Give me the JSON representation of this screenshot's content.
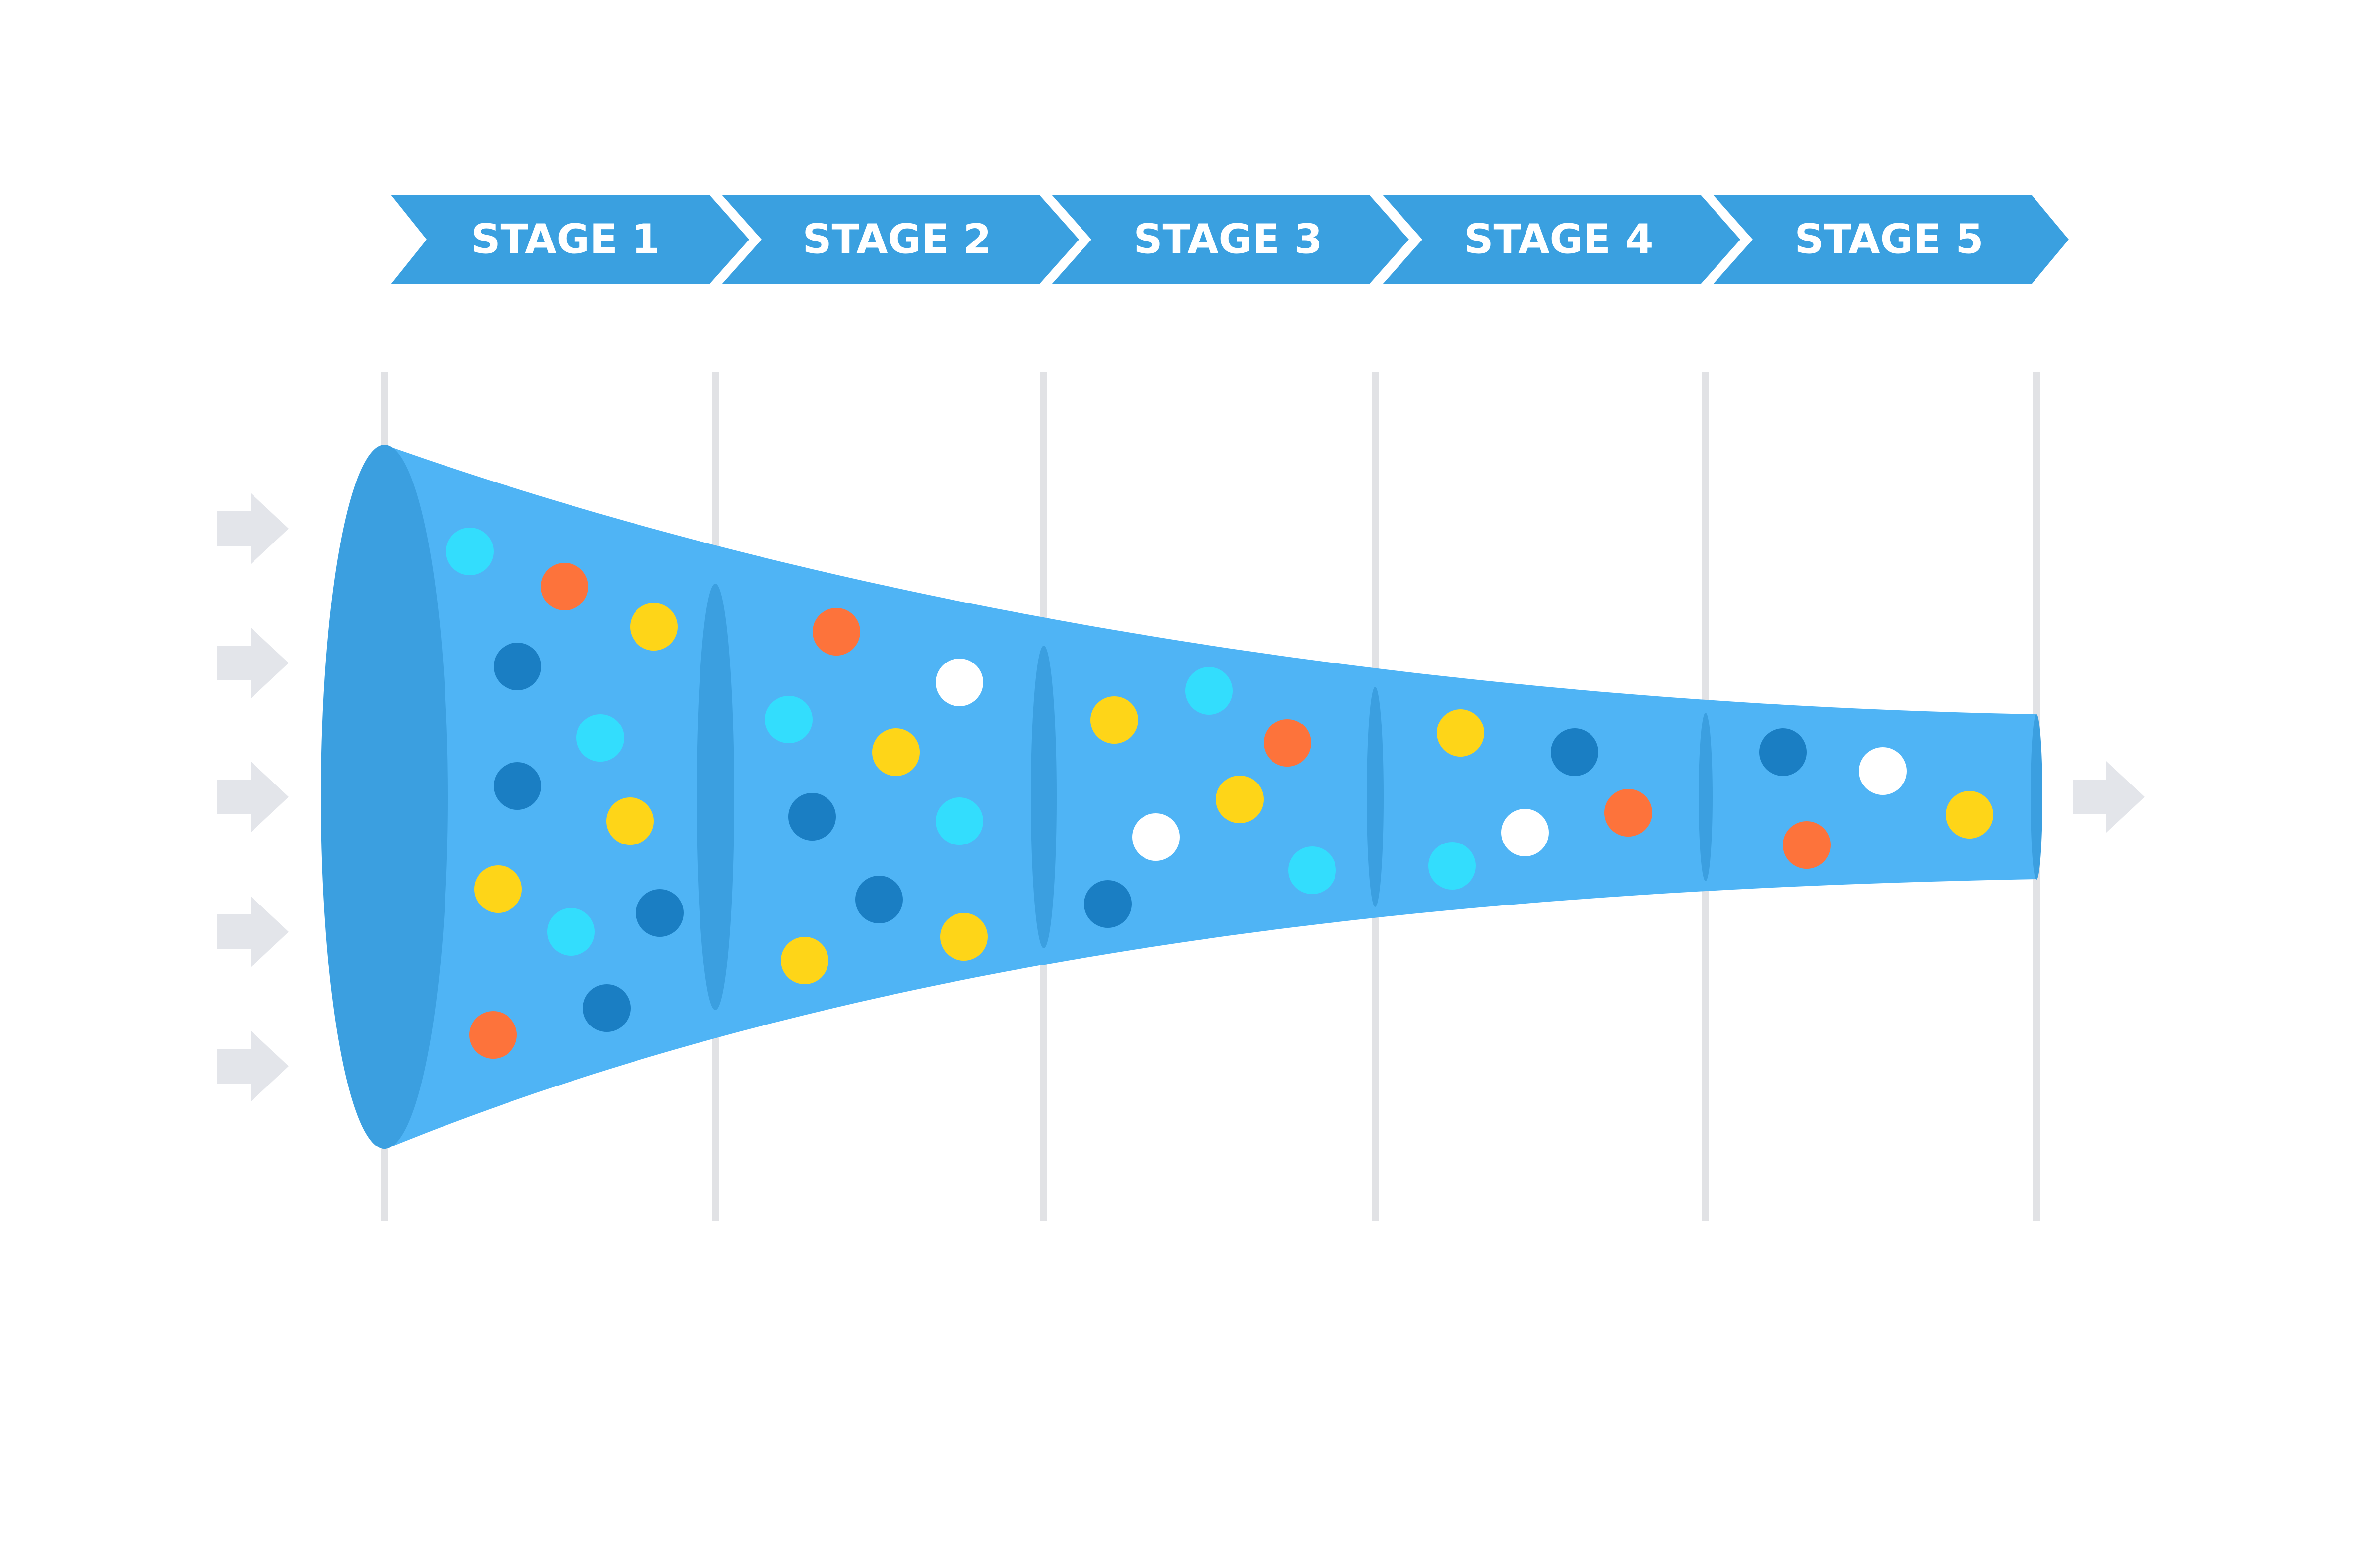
{
  "stages": [
    {
      "label": "STAGE 1"
    },
    {
      "label": "STAGE 2"
    },
    {
      "label": "STAGE 3"
    },
    {
      "label": "STAGE 4"
    },
    {
      "label": "STAGE 5"
    }
  ],
  "colors": {
    "stage_banner": "#3aa0e0",
    "funnel_body": "#4fb4f5",
    "funnel_section": "#3b9fe0",
    "divider_line": "#e1e2e5",
    "input_arrow": "#e3e5ea",
    "stage_text": "#ffffff"
  },
  "dot_palette": {
    "cyan": "#33ddfd",
    "orange": "#fd733b",
    "yellow": "#fed518",
    "navy": "#1a7ec3",
    "white": "#ffffff"
  },
  "funnel": {
    "input_arrow_count": 5,
    "output_arrow_count": 1,
    "sections": [
      {
        "stage": "STAGE 1",
        "dots": [
          "cyan",
          "orange",
          "yellow",
          "navy",
          "cyan",
          "navy",
          "yellow",
          "yellow",
          "cyan",
          "navy",
          "orange",
          "navy"
        ]
      },
      {
        "stage": "STAGE 2",
        "dots": [
          "orange",
          "white",
          "cyan",
          "yellow",
          "navy",
          "cyan",
          "navy",
          "yellow",
          "yellow"
        ]
      },
      {
        "stage": "STAGE 3",
        "dots": [
          "yellow",
          "cyan",
          "orange",
          "yellow",
          "white",
          "cyan",
          "navy"
        ]
      },
      {
        "stage": "STAGE 4",
        "dots": [
          "yellow",
          "navy",
          "orange",
          "white",
          "cyan"
        ]
      },
      {
        "stage": "STAGE 5",
        "dots": [
          "navy",
          "white",
          "yellow",
          "orange"
        ]
      }
    ]
  }
}
